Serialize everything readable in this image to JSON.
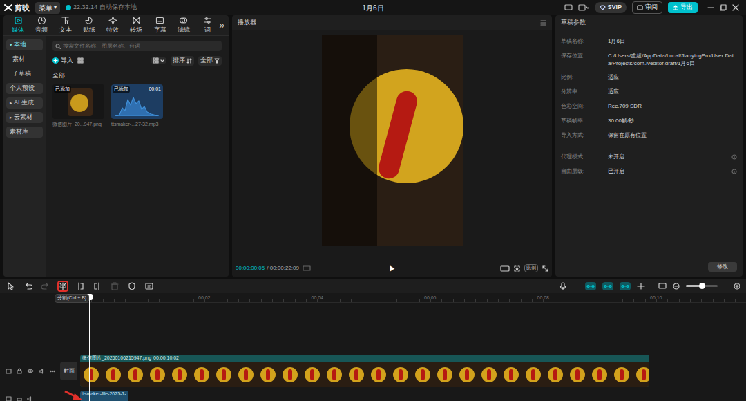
{
  "app": {
    "logo": "剪映",
    "menu": "菜单",
    "menu_arrow": "▾",
    "autosave": "22:32:14 自动保存本地",
    "title": "1月6日",
    "svip": "SVIP",
    "review": "审阅",
    "export": "导出"
  },
  "media_tabs": [
    {
      "label": "媒体",
      "selected": true
    },
    {
      "label": "音频",
      "selected": false
    },
    {
      "label": "文本",
      "selected": false
    },
    {
      "label": "贴纸",
      "selected": false
    },
    {
      "label": "特效",
      "selected": false
    },
    {
      "label": "转场",
      "selected": false
    },
    {
      "label": "字幕",
      "selected": false
    },
    {
      "label": "滤镜",
      "selected": false
    },
    {
      "label": "调",
      "selected": false
    }
  ],
  "more_tabs": "»",
  "sidebar": [
    {
      "label": "本地",
      "arrow": "▾",
      "kind": "group",
      "selected": true
    },
    {
      "label": "素材",
      "kind": "sub",
      "selected": false
    },
    {
      "label": "子草稿",
      "kind": "sub",
      "selected": false
    },
    {
      "label": "个人预设",
      "kind": "group",
      "selected": false
    },
    {
      "label": "AI 生成",
      "arrow": "▸",
      "kind": "group",
      "selected": false
    },
    {
      "label": "云素材",
      "arrow": "▸",
      "kind": "group",
      "selected": false
    },
    {
      "label": "素材库",
      "kind": "group",
      "selected": false
    }
  ],
  "search": {
    "placeholder": "搜索文件名称、图层名称、台词"
  },
  "media_toolbar": {
    "import": "导入",
    "sort": "排序",
    "filter": "全部"
  },
  "section": "全部",
  "media_items": [
    {
      "kind": "image",
      "badge": "已添加",
      "name": "微信图片_20...947.png"
    },
    {
      "kind": "audio",
      "badge": "已添加",
      "duration": "00:01",
      "name": "ttsmaker-...27-32.mp3"
    }
  ],
  "player": {
    "title": "播放器",
    "current": "00:00:00:05",
    "total": "/ 00:00:22:09",
    "play": "▶",
    "ratio": "比例"
  },
  "draft": {
    "title": "草稿参数",
    "fields": [
      {
        "label": "草稿名称:",
        "value": "1月6日"
      },
      {
        "label": "保存位置:",
        "value": "C:/Users/孟超/AppData/Local/JianyingPro/User Data/Projects/com.lveditor.draft/1月6日"
      },
      {
        "label": "比例:",
        "value": "适应"
      },
      {
        "label": "分辨率:",
        "value": "适应"
      },
      {
        "label": "色彩空间:",
        "value": "Rec.709 SDR"
      },
      {
        "label": "草稿帧率:",
        "value": "30.00帧/秒"
      },
      {
        "label": "导入方式:",
        "value": "保留在原有位置"
      }
    ],
    "extra_fields": [
      {
        "label": "代理模式:",
        "value": "未开启"
      },
      {
        "label": "自由层级:",
        "value": "已开启"
      }
    ],
    "button": "修改"
  },
  "tools": [
    {
      "kind": "select",
      "highlighted": false,
      "disabled": false
    },
    {
      "kind": "undo",
      "highlighted": false,
      "disabled": false
    },
    {
      "kind": "redo",
      "highlighted": false,
      "disabled": true
    },
    {
      "kind": "split",
      "highlighted": true,
      "disabled": false
    },
    {
      "kind": "splitleft",
      "highlighted": false,
      "disabled": false
    },
    {
      "kind": "splitright",
      "highlighted": false,
      "disabled": false
    },
    {
      "kind": "delete",
      "highlighted": false,
      "disabled": true
    },
    {
      "kind": "shield",
      "highlighted": false,
      "disabled": false
    },
    {
      "kind": "ai",
      "highlighted": false,
      "disabled": false
    }
  ],
  "track_toggles": [
    {
      "on": true
    },
    {
      "on": true
    },
    {
      "on": true
    }
  ],
  "zoom": {
    "level": 0.5
  },
  "timeline": {
    "tooltip": "分割(Ctrl + B)",
    "ruler": [
      "00:02",
      "00:04",
      "00:06",
      "00:08",
      "00:10"
    ],
    "video": {
      "label": "微信图片_20250106215947.png",
      "duration": "00:00:10:02",
      "cover": "封面"
    },
    "audio": {
      "label": "ttsmaker-file-2025-1-"
    }
  }
}
